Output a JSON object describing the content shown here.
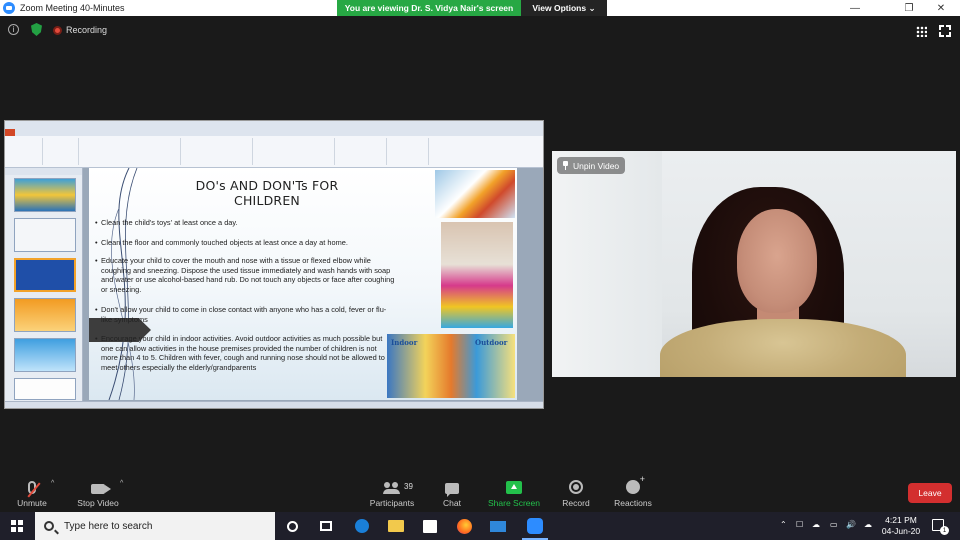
{
  "window": {
    "title": "Zoom Meeting 40-Minutes",
    "controls": [
      "—",
      "❐",
      "✕"
    ]
  },
  "banner": {
    "viewing_text": "You are viewing Dr. S. Vidya Nair's screen",
    "view_options": "View Options ⌄"
  },
  "status": {
    "info_glyph": "i",
    "recording_label": "Recording"
  },
  "presentation": {
    "slide_title": "DO's AND DON'Ts FOR CHILDREN",
    "bullets": [
      "Clean the child's toys' at least once a day.",
      "Clean the floor and commonly touched objects at least once a day at home.",
      "Educate your child to cover the mouth and nose with a tissue or flexed elbow while coughing and sneezing. Dispose the used tissue immediately and wash hands with soap and water or use alcohol-based hand rub. Do not touch any objects or face after coughing or sneezing.",
      "Don't allow your child to come in close contact with anyone who has a cold, fever or flu-like symptoms",
      "Encourage your child in indoor activities. Avoid outdoor activities as much possible but one can allow activities in the house premises provided the number of children is not more than 4 to 5. Children with fever, cough and running nose should not be allowed to meet others especially the elderly/grandparents"
    ],
    "image_labels": {
      "indoor": "Indoor",
      "outdoor": "Outdoor"
    }
  },
  "video": {
    "unpin_label": "Unpin Video"
  },
  "toolbar": {
    "unmute": "Unmute",
    "stop_video": "Stop Video",
    "participants": "Participants",
    "participants_count": "39",
    "chat": "Chat",
    "share_screen": "Share Screen",
    "record": "Record",
    "reactions": "Reactions",
    "leave": "Leave",
    "caret": "^"
  },
  "taskbar": {
    "search_placeholder": "Type here to search",
    "time": "4:21 PM",
    "date": "04-Jun-20",
    "notification_count": "1",
    "tray_icons": [
      "⌃",
      "☐",
      "☁",
      "▭",
      "🔊",
      "☁"
    ]
  },
  "colors": {
    "zoom_blue": "#2d8cff",
    "share_green": "#23c04b",
    "banner_green": "#27a844",
    "leave_red": "#d32f2f"
  }
}
